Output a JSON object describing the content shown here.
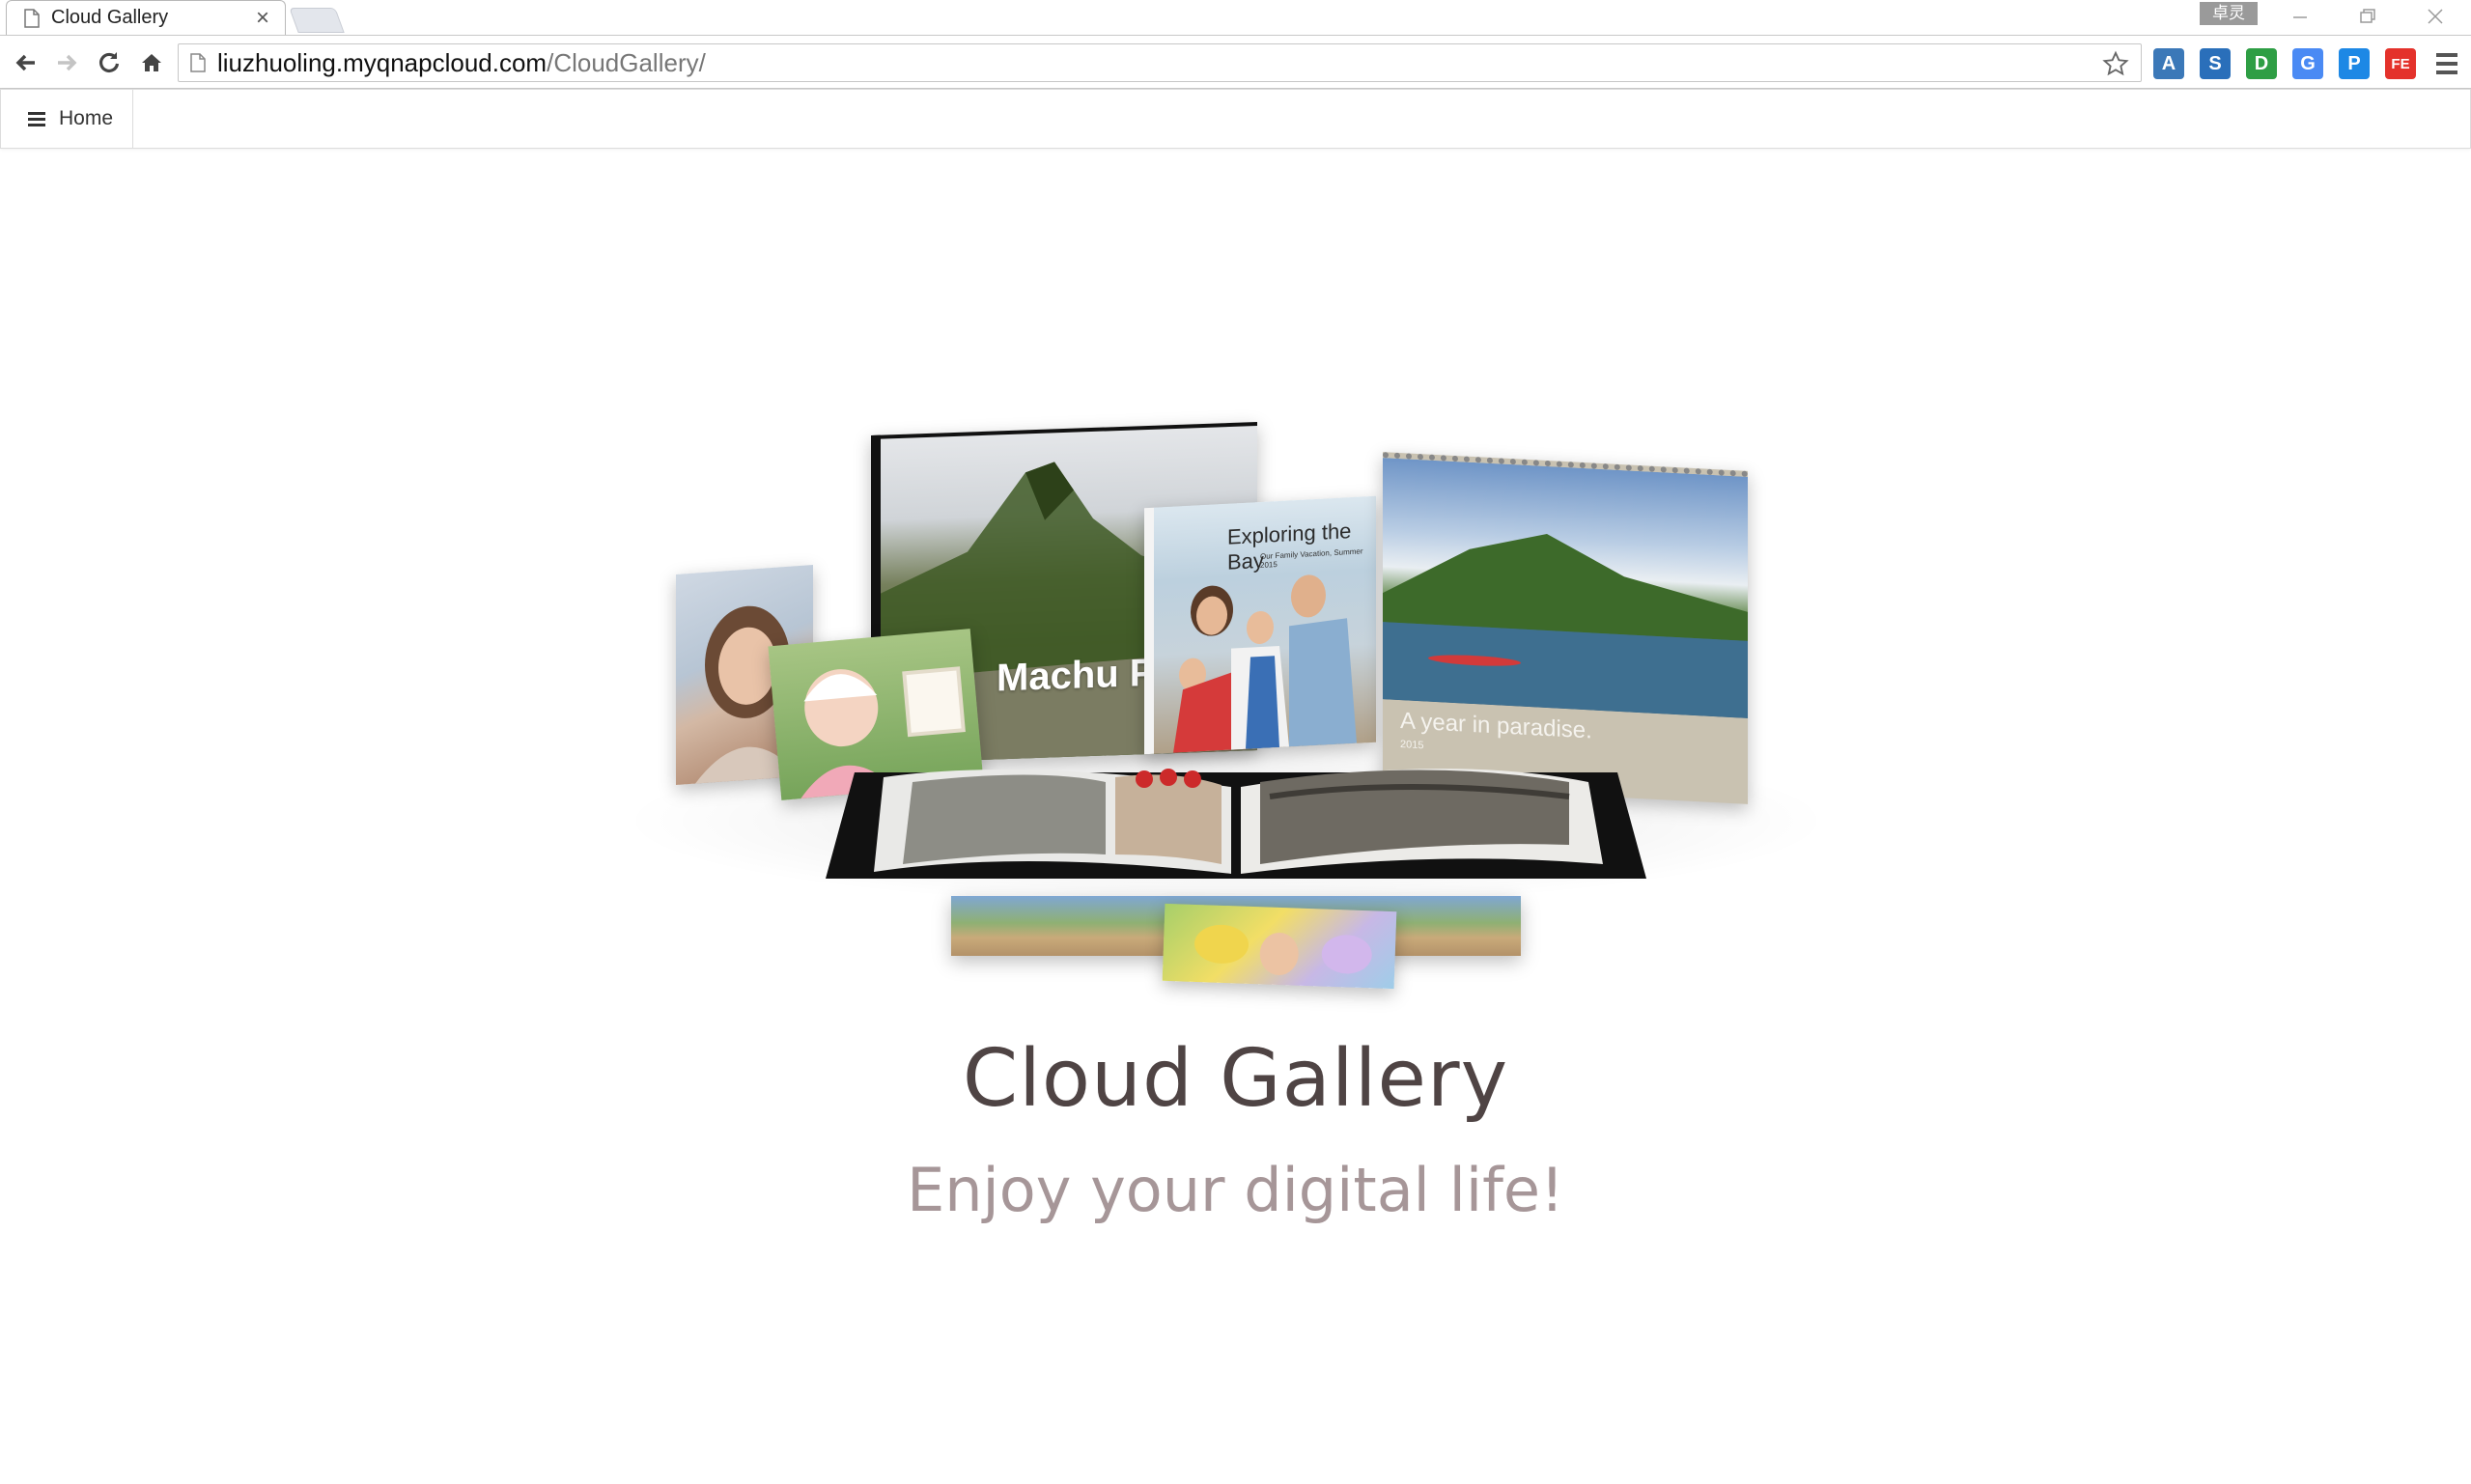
{
  "browser": {
    "tab_title": "Cloud Gallery",
    "tab_close": "×",
    "profile_badge": "卓灵",
    "url_host": "liuzhuoling.myqnapcloud.com",
    "url_path": "/CloudGallery/",
    "extensions": [
      {
        "name": "translate-ext-icon",
        "glyph": "A",
        "color": "#3b78b8"
      },
      {
        "name": "s-ext-icon",
        "glyph": "S",
        "color": "#2a6fba"
      },
      {
        "name": "green-ext-icon",
        "glyph": "D",
        "color": "#2e9e44"
      },
      {
        "name": "google-translate-icon",
        "glyph": "G",
        "color": "#4a8af4"
      },
      {
        "name": "p-ext-icon",
        "glyph": "P",
        "color": "#1d88e5"
      },
      {
        "name": "fe-ext-icon",
        "glyph": "FE",
        "color": "#e4322b"
      }
    ]
  },
  "site_nav": {
    "home_label": "Home"
  },
  "hero": {
    "title": "Cloud Gallery",
    "subtitle": "Enjoy your digital life!",
    "product_texts": {
      "book_cover_text": "Machu P",
      "photobook_title": "Exploring the Bay",
      "photobook_subtitle": "Our Family Vacation, Summer 2015",
      "calendar_caption": "A year in paradise.",
      "calendar_year": "2015"
    }
  },
  "colors": {
    "title": "#4f4444",
    "subtitle": "#a69698"
  }
}
